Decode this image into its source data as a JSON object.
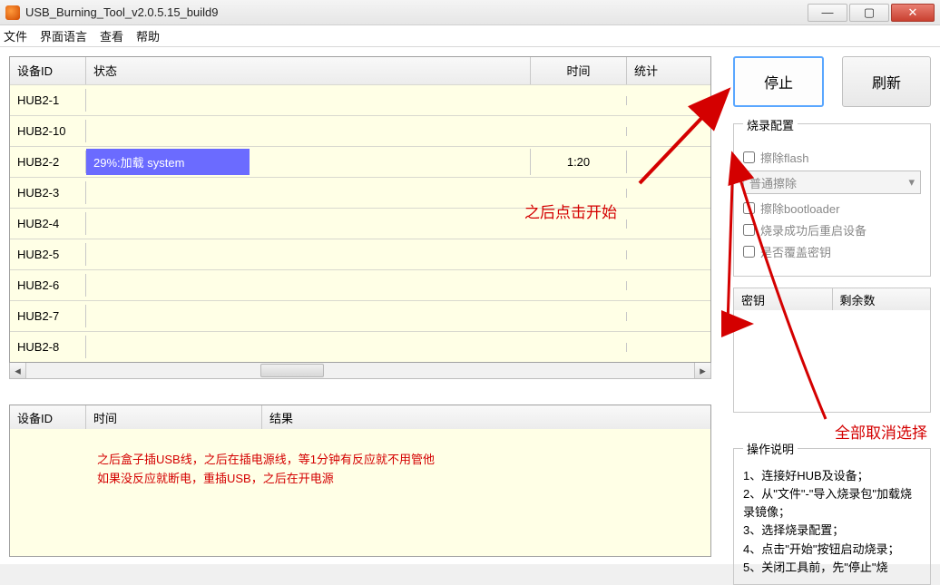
{
  "window": {
    "title": "USB_Burning_Tool_v2.0.5.15_build9"
  },
  "menu": {
    "file": "文件",
    "lang": "界面语言",
    "view": "查看",
    "help": "帮助"
  },
  "devTable": {
    "headers": {
      "id": "设备ID",
      "status": "状态",
      "time": "时间",
      "count": "统计"
    },
    "rows": [
      {
        "id": "HUB2-1",
        "status": "",
        "time": ""
      },
      {
        "id": "HUB2-10",
        "status": "",
        "time": ""
      },
      {
        "id": "HUB2-2",
        "status": "29%:加载 system",
        "time": "1:20",
        "active": true
      },
      {
        "id": "HUB2-3",
        "status": "",
        "time": ""
      },
      {
        "id": "HUB2-4",
        "status": "",
        "time": ""
      },
      {
        "id": "HUB2-5",
        "status": "",
        "time": ""
      },
      {
        "id": "HUB2-6",
        "status": "",
        "time": ""
      },
      {
        "id": "HUB2-7",
        "status": "",
        "time": ""
      },
      {
        "id": "HUB2-8",
        "status": "",
        "time": ""
      }
    ]
  },
  "logTable": {
    "headers": {
      "id": "设备ID",
      "time": "时间",
      "result": "结果"
    },
    "note1": "之后盒子插USB线，之后在插电源线，等1分钟有反应就不用管他",
    "note2": "如果没反应就断电，重插USB，之后在开电源"
  },
  "annotations": {
    "clickStart": "之后点击开始",
    "uncheckAll": "全部取消选择"
  },
  "buttons": {
    "stop": "停止",
    "refresh": "刷新"
  },
  "burnCfg": {
    "title": "烧录配置",
    "eraseFlash": "擦除flash",
    "eraseMode": "普通擦除",
    "eraseBootloader": "擦除bootloader",
    "rebootAfter": "烧录成功后重启设备",
    "overwriteKey": "是否覆盖密钥"
  },
  "keyTable": {
    "c1": "密钥",
    "c2": "剩余数"
  },
  "instructions": {
    "title": "操作说明",
    "l1": "1、连接好HUB及设备；",
    "l2": "2、从\"文件\"-\"导入烧录包\"加载烧录镜像；",
    "l3": "3、选择烧录配置；",
    "l4": "4、点击\"开始\"按钮启动烧录；",
    "l5": "5、关闭工具前，先\"停止\"烧"
  }
}
